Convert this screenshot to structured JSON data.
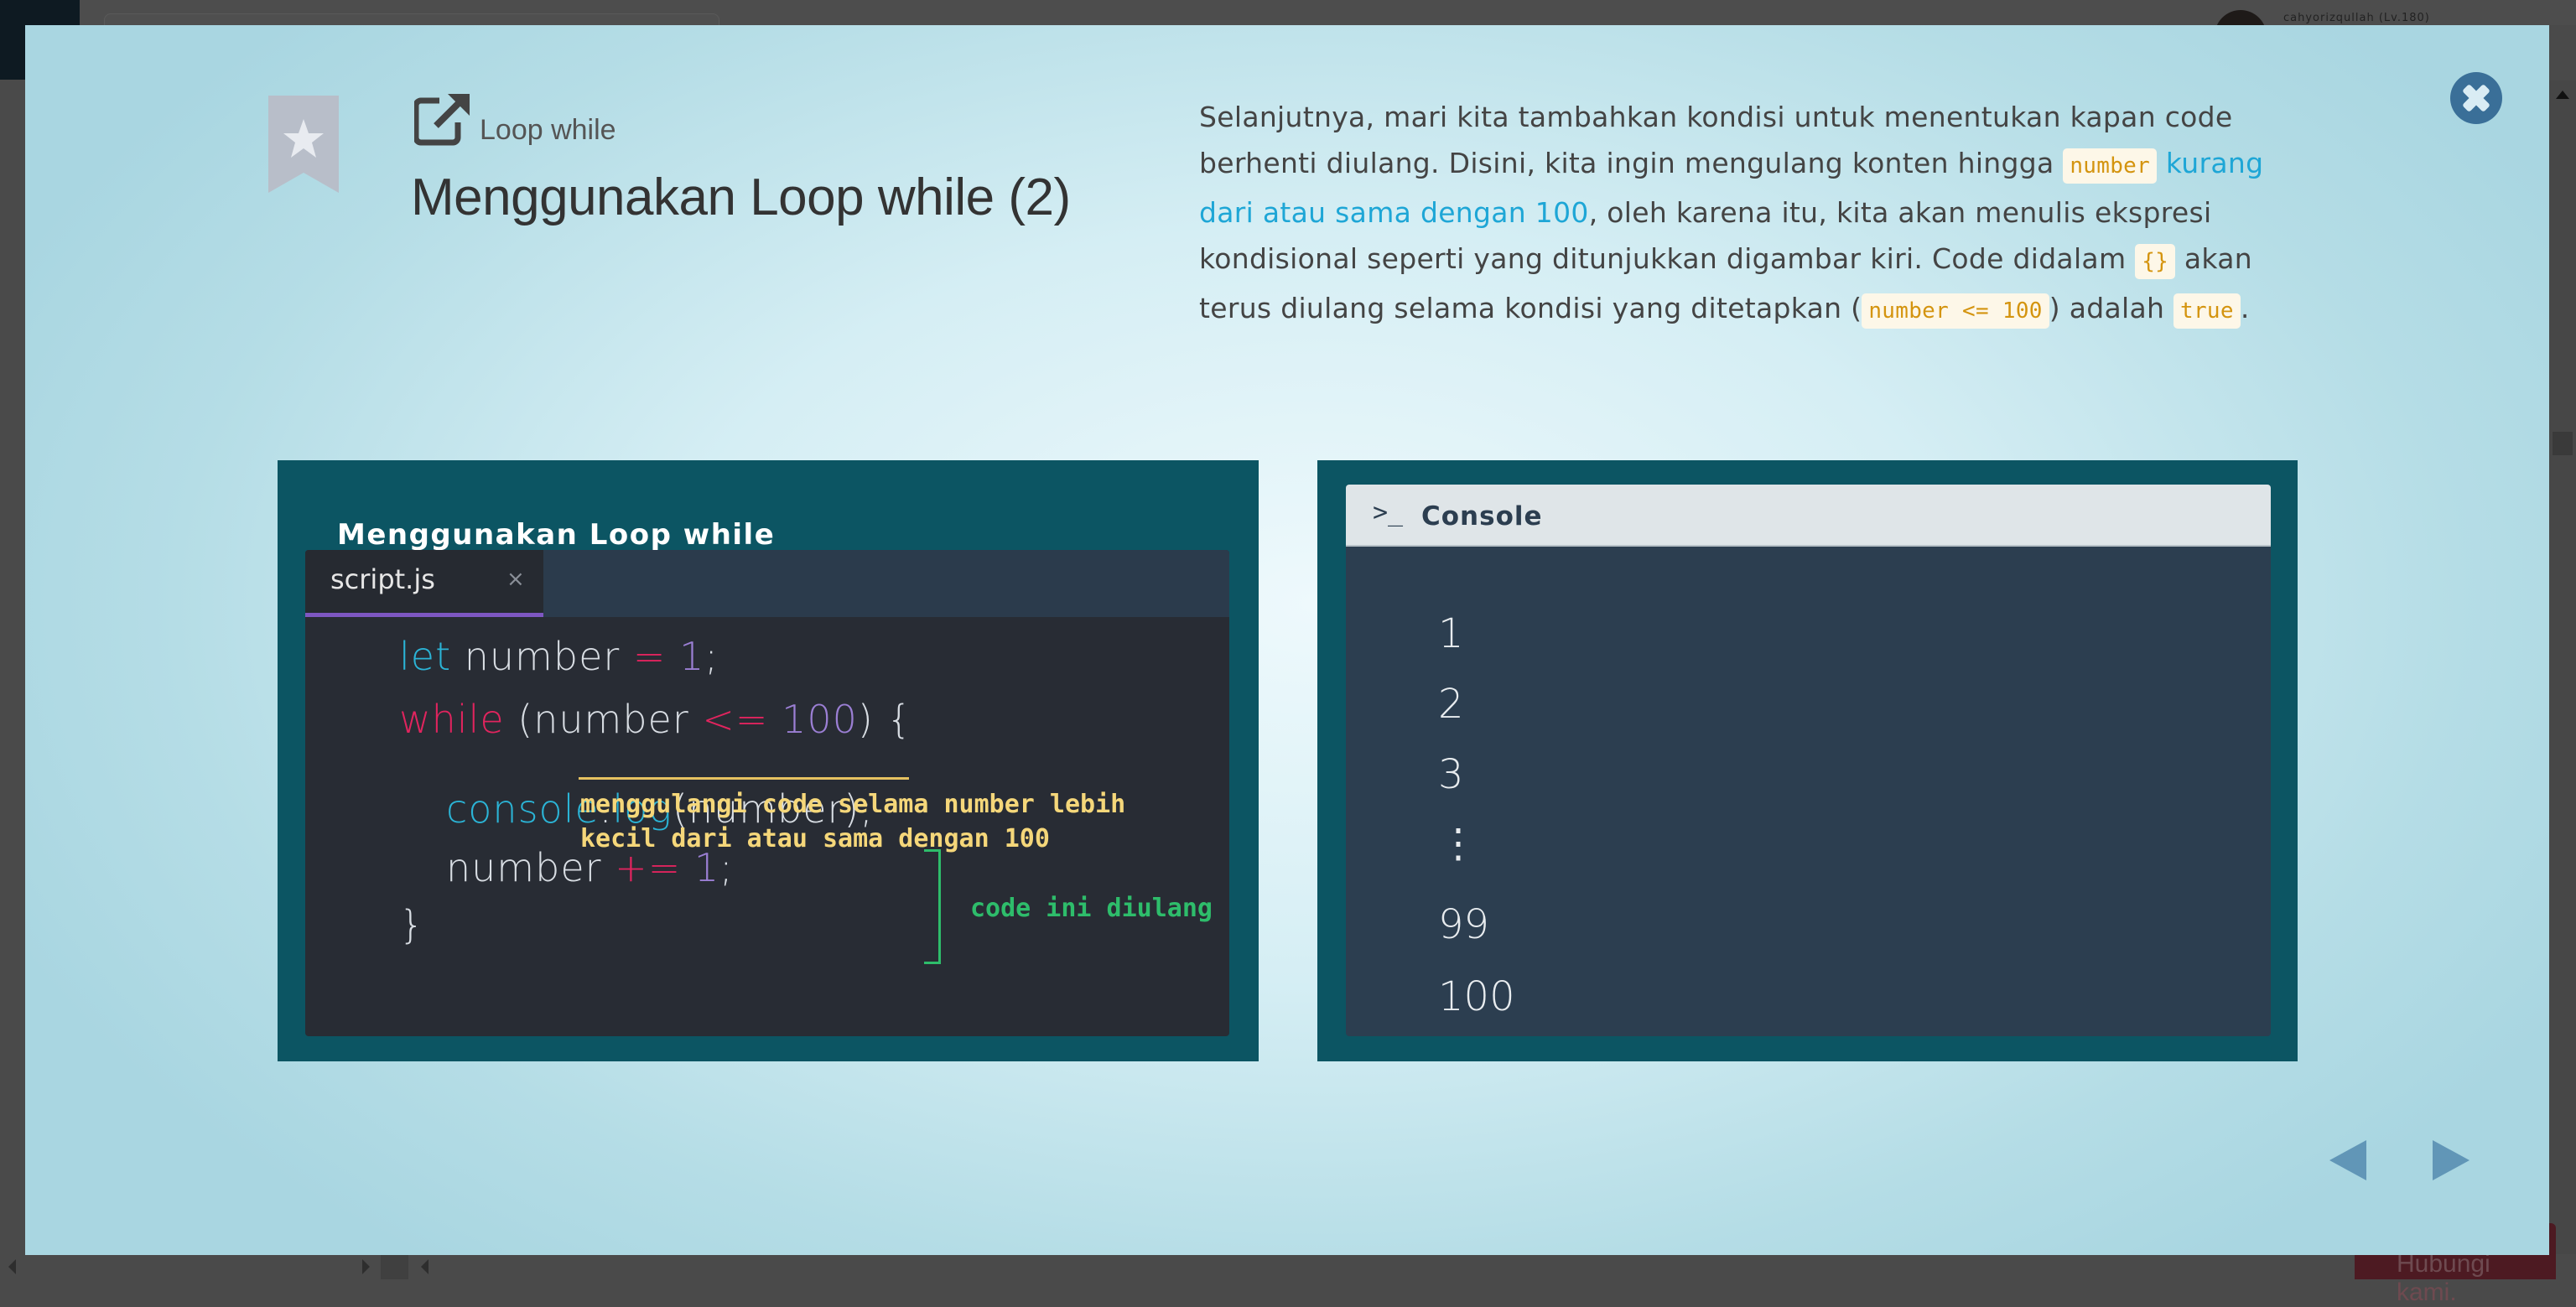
{
  "header": {
    "username": "cahyorizqullah (Lv.180)"
  },
  "footer": {
    "contact_label": "Hubungi kami."
  },
  "slide": {
    "breadcrumb": "Loop while",
    "title": "Menggunakan Loop while (2)",
    "description": [
      {
        "t": "Selanjutnya, mari kita tambahkan kondisi untuk menentukan kapan code berhenti diulang. Disini, kita ingin mengulang konten hingga ",
        "k": "text"
      },
      {
        "t": "number",
        "k": "code"
      },
      {
        "t": " ",
        "k": "text"
      },
      {
        "t": "kurang dari atau sama dengan 100",
        "k": "link"
      },
      {
        "t": ", oleh karena itu, kita akan menulis ekspresi kondisional seperti yang ditunjukkan digambar kiri. Code didalam ",
        "k": "text"
      },
      {
        "t": "{}",
        "k": "code"
      },
      {
        "t": " akan terus diulang selama kondisi yang ditetapkan (",
        "k": "text"
      },
      {
        "t": "number <= 100",
        "k": "code"
      },
      {
        "t": ") adalah ",
        "k": "text"
      },
      {
        "t": "true",
        "k": "code"
      },
      {
        "t": ".",
        "k": "text"
      }
    ]
  },
  "code_panel": {
    "title": "Menggunakan Loop while",
    "tab": "script.js",
    "tab_close": "×",
    "lines": [
      [
        {
          "t": "let",
          "c": "k-cyan"
        },
        {
          "t": " number "
        },
        {
          "t": "=",
          "c": "k-red"
        },
        {
          "t": " "
        },
        {
          "t": "1",
          "c": "k-num"
        },
        {
          "t": ";"
        }
      ],
      [
        {
          "t": "while",
          "c": "k-red"
        },
        {
          "t": " (number "
        },
        {
          "t": "<=",
          "c": "k-red"
        },
        {
          "t": " "
        },
        {
          "t": "100",
          "c": "k-num"
        },
        {
          "t": ") {"
        }
      ],
      [
        {
          "t": "console",
          "c": "k-cyan"
        },
        {
          "t": "."
        },
        {
          "t": "log",
          "c": "k-cyan"
        },
        {
          "t": "(number);"
        }
      ],
      [
        {
          "t": "number "
        },
        {
          "t": "+=",
          "c": "k-red"
        },
        {
          "t": " "
        },
        {
          "t": "1",
          "c": "k-num"
        },
        {
          "t": ";"
        }
      ],
      [
        {
          "t": "}"
        }
      ]
    ],
    "condition_note": [
      "menggulangi code selama number lebih",
      "kecil dari atau sama dengan 100"
    ],
    "repeat_note": "code ini diulang"
  },
  "console_panel": {
    "label": "Console",
    "prompt_icon": ">_",
    "output": [
      "1",
      "2",
      "3",
      "⋮",
      "99",
      "100"
    ]
  },
  "colors": {
    "panel": "#0c5563",
    "accent": "#3a6f98",
    "code_note": "#f5d77a",
    "repeat_note": "#2ebd6b"
  }
}
